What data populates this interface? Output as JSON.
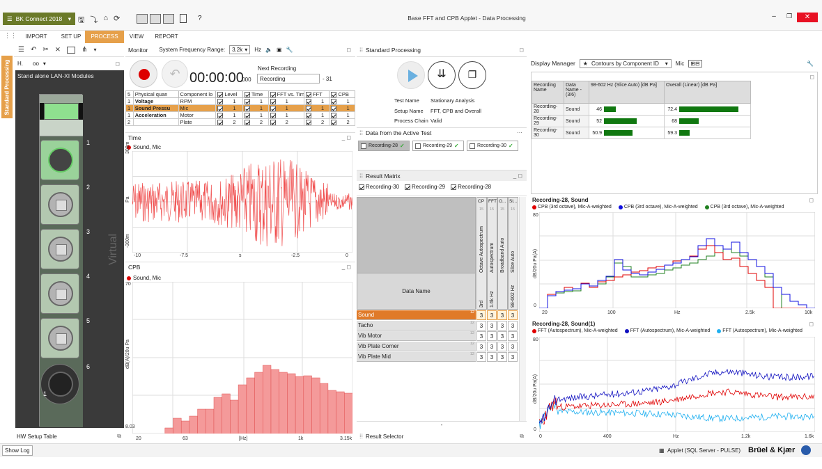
{
  "titlebar": {
    "app_menu": "BK Connect 2018",
    "window_title": "Base FFT and CPB Applet - Data Processing",
    "help": "?"
  },
  "ribbon_tabs": [
    "IMPORT",
    "SET UP",
    "PROCESS",
    "VIEW",
    "REPORT"
  ],
  "active_tab": "PROCESS",
  "left_toolbar": {
    "h_label": "H."
  },
  "vertical_tab": "Standard Processing",
  "hw_panel": {
    "title": "Stand alone LAN-XI Modules",
    "watermark": "Virtual",
    "channels": [
      "1",
      "2",
      "3",
      "4",
      "5",
      "6"
    ],
    "channel_extra": [
      "1",
      "2"
    ],
    "footer": "HW Setup Table"
  },
  "monitor": {
    "title": "Monitor",
    "freq_label": "System Frequency Range:",
    "freq_value": "3.2k",
    "freq_unit": "Hz",
    "timer_main": "00:00:00",
    "timer_ms": ".000",
    "next_recording_label": "Next Recording",
    "next_recording_name": "Recording",
    "next_recording_num": "- 31"
  },
  "channel_table": {
    "headers": [
      "5",
      "Physical quan",
      "Component lo",
      "Level",
      "Time",
      "FFT vs. Time",
      "FFT",
      "CPB"
    ],
    "rows": [
      {
        "n": "1",
        "quantity": "Voltage",
        "component": "RPM",
        "vals": [
          "1",
          "1",
          "1",
          "1",
          "1"
        ],
        "selected": false
      },
      {
        "n": "1",
        "quantity": "Sound Pressu",
        "component": "Mic",
        "vals": [
          "1",
          "1",
          "1",
          "1",
          "1"
        ],
        "selected": true
      },
      {
        "n": "1",
        "quantity": "Acceleration",
        "component": "Motor",
        "vals": [
          "1",
          "1",
          "1",
          "1",
          "1"
        ],
        "selected": false
      },
      {
        "n": "2",
        "quantity": "",
        "component": "Plate",
        "vals": [
          "2",
          "2",
          "2",
          "2",
          "2"
        ],
        "selected": false
      }
    ]
  },
  "time_panel": {
    "title": "Time",
    "legend": "Sound, Mic",
    "yticks": [
      "300m",
      "Pa",
      "-300m"
    ],
    "xticks": [
      "-10",
      "-7.5",
      "s",
      "-2.5",
      "0"
    ]
  },
  "cpb_panel": {
    "title": "CPB",
    "legend": "Sound, Mic",
    "yticks": [
      "70",
      "dB(A)/20u Pa",
      "8.03"
    ],
    "xticks": [
      "20",
      "63",
      "[Hz]",
      "1k",
      "3.15k"
    ]
  },
  "standard_processing": {
    "title": "Standard Processing",
    "test_name_label": "Test Name",
    "test_name": "Stationary Analysis",
    "setup_name_label": "Setup Name",
    "setup_name": "FFT, CPB and Overall",
    "process_chain_label": "Process Chain",
    "process_chain": "Valid"
  },
  "active_test": {
    "title": "Data from the Active Test",
    "recordings": [
      "Recording-28",
      "Recording-29",
      "Recording-30"
    ]
  },
  "result_matrix": {
    "title": "Result Matrix",
    "filters": [
      "Recording-30",
      "Recording-29",
      "Recording-28"
    ],
    "col_heads": [
      "CP",
      "FFT",
      "O...",
      "Sl..."
    ],
    "col_nums": [
      "15",
      "15",
      "15",
      "15"
    ],
    "col_labels": [
      "Octave Autospectrum",
      "Autospectrum",
      "Broadband Auto",
      "Slice Auto"
    ],
    "col_sub": [
      "3rd",
      "1.6k Hz",
      "",
      "98-602 Hz"
    ],
    "data_name_label": "Data Name",
    "rows": [
      {
        "name": "Sound",
        "badge": "12",
        "vals": [
          "3",
          "3",
          "3",
          "3"
        ],
        "selected": true
      },
      {
        "name": "Tacho",
        "badge": "12",
        "vals": [
          "3",
          "3",
          "3",
          "3"
        ],
        "selected": false
      },
      {
        "name": "Vib Motor",
        "badge": "12",
        "vals": [
          "3",
          "3",
          "3",
          "3"
        ],
        "selected": false
      },
      {
        "name": "Vib Plate Corner",
        "badge": "12",
        "vals": [
          "3",
          "3",
          "3",
          "3"
        ],
        "selected": false
      },
      {
        "name": "Vib Plate Mid",
        "badge": "12",
        "vals": [
          "3",
          "3",
          "3",
          "3"
        ],
        "selected": false
      }
    ],
    "footer_dash": "-",
    "result_selector": "Result Selector"
  },
  "display_manager": {
    "title": "Display Manager",
    "dropdown": "Contours by Component ID",
    "mic_label": "Mic",
    "table_headers": [
      "Recording Name",
      "Data Name - (3/6)",
      "98-602 Hz (Slice Auto) [dB Pa]",
      "Overall (Linear) [dB Pa]"
    ],
    "rows": [
      {
        "rec": "Recording-28",
        "data": "Sound",
        "slice": "46",
        "overall": "72.4",
        "slice_frac": 0.28,
        "overall_frac": 0.85
      },
      {
        "rec": "Recording-29",
        "data": "Sound",
        "slice": "52",
        "overall": "68",
        "slice_frac": 0.78,
        "overall_frac": 0.28
      },
      {
        "rec": "Recording-30",
        "data": "Sound",
        "slice": "50.9",
        "overall": "59.3",
        "slice_frac": 0.68,
        "overall_frac": 0.15
      }
    ]
  },
  "cpb_chart": {
    "title": "Recording-28, Sound",
    "legend": [
      "CPB (3rd octave), Mic-A-weighted",
      "CPB (3rd octave), Mic-A-weighted",
      "CPB (3rd octave), Mic-A-weighted"
    ],
    "colors": [
      "#e00000",
      "#1010e0",
      "#208020"
    ],
    "ylabel": "dB/20u Pa(A)",
    "yticks": [
      "80",
      "0"
    ],
    "xticks": [
      "20",
      "100",
      "Hz",
      "2.5k",
      "10k"
    ]
  },
  "fft_chart": {
    "title": "Recording-28, Sound(1)",
    "legend": [
      "FFT (Autospectrum), Mic-A-weighted",
      "FFT (Autospectrum), Mic-A-weighted",
      "FFT (Autospectrum), Mic-A-weighted"
    ],
    "colors": [
      "#e00000",
      "#1010c0",
      "#20b0f0"
    ],
    "ylabel": "dB/20u Pa(A)",
    "yticks": [
      "80",
      "0"
    ],
    "xticks": [
      "0",
      "400",
      "Hz",
      "1.2k",
      "1.6k"
    ]
  },
  "statusbar": {
    "show_log": "Show Log",
    "applet": "Applet (SQL Server - PULSE)",
    "brand": "Brüel & Kjær"
  }
}
